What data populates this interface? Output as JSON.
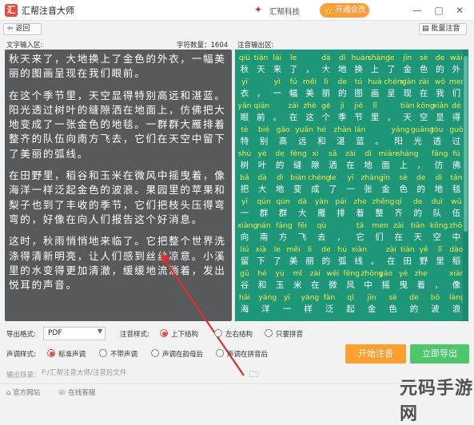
{
  "window": {
    "title": "汇帮注音大师",
    "brand": "汇帮科技",
    "vip_label": "开通会员",
    "minimize": "—",
    "maximize": "▢",
    "close": "✕"
  },
  "toolbar": {
    "back_label": "返回",
    "batch_label": "批量注音"
  },
  "input_area": {
    "label": "文字输入区:",
    "char_count_label": "字符数量：1604",
    "paragraphs": [
      "秋天来了，大地换上了金色的外衣，一幅美丽的图画呈现在我们眼前。",
      "在这个季节里，天空显得特别高远和湛蓝。阳光透过树叶的缝隙洒在地面上，仿佛把大地变成了一张金色的地毯。一群群大雁排着整齐的队伍向南方飞去，它们在天空中留下了美丽的弧线。",
      "在田野里，稻谷和玉米在微风中摇曳着，像海洋一样泛起金色的波浪。果园里的苹果和梨子也到了丰收的季节，它们把枝头压得弯弯的，好像在向人们报告这个好消息。",
      "这时，秋雨悄悄地来临了。它把整个世界洗涤得清新明亮，让人们感到丝丝凉意。小溪里的水变得更加清澈，缓缓地流淌着，发出悦耳的声音。"
    ]
  },
  "output_area": {
    "label": "注音输出区:",
    "rows": [
      {
        "py": [
          "qiū",
          "tiān",
          "lái",
          "le",
          "",
          "dà",
          "dì",
          "huàn",
          "shàng",
          "le",
          "jīn",
          "sè",
          "de",
          "wài"
        ],
        "hz": [
          "秋",
          "天",
          "来",
          "了",
          "，",
          "大",
          "地",
          "换",
          "上",
          "了",
          "金",
          "色",
          "的",
          "外"
        ]
      },
      {
        "py": [
          "yī",
          "",
          "yì",
          "fú",
          "měi",
          "lì",
          "de",
          "tú",
          "huà",
          "chéng",
          "xiàn",
          "zài",
          "wǒ",
          "men"
        ],
        "hz": [
          "衣",
          "，",
          "一",
          "幅",
          "美",
          "丽",
          "的",
          "图",
          "画",
          "呈",
          "现",
          "在",
          "我",
          "们"
        ]
      },
      {
        "py": [
          "yǎn",
          "qián",
          "",
          "zài",
          "zhè",
          "gè",
          "jì",
          "jié",
          "lǐ",
          "",
          "tiān",
          "kōng",
          "xiǎn",
          "dé"
        ],
        "hz": [
          "眼",
          "前",
          "。",
          "在",
          "这",
          "个",
          "季",
          "节",
          "里",
          "，",
          "天",
          "空",
          "显",
          "得"
        ]
      },
      {
        "py": [
          "tè",
          "bié",
          "gāo",
          "yuǎn",
          "hé",
          "zhàn",
          "lán",
          "",
          "yáng",
          "guāng",
          "tòu",
          "guò"
        ],
        "hz": [
          "特",
          "别",
          "高",
          "远",
          "和",
          "湛",
          "蓝",
          "。",
          "阳",
          "光",
          "透",
          "过"
        ]
      },
      {
        "py": [
          "shù",
          "yè",
          "de",
          "fèng",
          "xì",
          "sǎ",
          "zài",
          "dì",
          "miàn",
          "shàng",
          "",
          "fǎng",
          "fú"
        ],
        "hz": [
          "树",
          "叶",
          "的",
          "缝",
          "隙",
          "洒",
          "在",
          "地",
          "面",
          "上",
          "，",
          "仿",
          "佛"
        ]
      },
      {
        "py": [
          "bǎ",
          "dà",
          "dì",
          "biàn",
          "chéng",
          "le",
          "yī",
          "zhāng",
          "jīn",
          "sè",
          "de",
          "dì",
          "tǎn"
        ],
        "hz": [
          "把",
          "大",
          "地",
          "变",
          "成",
          "了",
          "一",
          "张",
          "金",
          "色",
          "的",
          "地",
          "毯"
        ]
      },
      {
        "py": [
          "yī",
          "qún",
          "qún",
          "dà",
          "yàn",
          "pái",
          "zhe",
          "zhěng",
          "qí",
          "de",
          "duì",
          "wǔ"
        ],
        "hz": [
          "一",
          "群",
          "群",
          "大",
          "雁",
          "排",
          "着",
          "整",
          "齐",
          "的",
          "队",
          "伍"
        ]
      },
      {
        "py": [
          "xiàng",
          "nán",
          "fāng",
          "fēi",
          "qù",
          "",
          "tā",
          "men",
          "zài",
          "tiān",
          "kōng",
          "zhōng"
        ],
        "hz": [
          "向",
          "南",
          "方",
          "飞",
          "去",
          "，",
          "它",
          "们",
          "在",
          "天",
          "空",
          "中"
        ]
      },
      {
        "py": [
          "liú",
          "xià",
          "le",
          "měi",
          "lì",
          "de",
          "hú",
          "xiàn",
          "",
          "zài",
          "tián",
          "yě",
          "lǐ",
          "dào"
        ],
        "hz": [
          "留",
          "下",
          "了",
          "美",
          "丽",
          "的",
          "弧",
          "线",
          "。",
          "在",
          "田",
          "野",
          "里",
          "稻"
        ]
      },
      {
        "py": [
          "gǔ",
          "hé",
          "yù",
          "mǐ",
          "zài",
          "wēi",
          "fēng",
          "zhōng",
          "yáo",
          "yè",
          "zhe",
          "",
          "xiàng"
        ],
        "hz": [
          "谷",
          "和",
          "玉",
          "米",
          "在",
          "微",
          "风",
          "中",
          "摇",
          "曳",
          "着",
          "，",
          "像"
        ]
      },
      {
        "py": [
          "hǎi",
          "yáng",
          "yī",
          "yàng",
          "fàn",
          "qǐ",
          "jīn",
          "sè",
          "de",
          "bō",
          "làng"
        ],
        "hz": [
          "海",
          "洋",
          "一",
          "样",
          "泛",
          "起",
          "金",
          "色",
          "的",
          "波",
          "浪"
        ]
      }
    ]
  },
  "settings": {
    "export_format_label": "导出格式:",
    "export_format_value": "PDF",
    "pinyin_style_label": "注音样式:",
    "pinyin_options": [
      "上下结构",
      "左右结构",
      "只要拼音"
    ],
    "pinyin_selected": 0,
    "tone_style_label": "声调样式:",
    "tone_options": [
      "标准声调",
      "不带声调",
      "声调在韵母后",
      "声调在拼音后"
    ],
    "tone_selected": 0,
    "start_label": "开始注音",
    "export_label": "立即导出",
    "output_dir_label": "输出目录:",
    "output_dir_value": "F:/汇帮注音大师/注音后文件"
  },
  "statusbar": {
    "website_label": "官方网站",
    "support_label": "在线客服"
  },
  "watermark": "元码手游网",
  "colors": {
    "left_pane": "#58595b",
    "right_pane": "#1e9678",
    "pinyin": "#f5e94a",
    "start_button": "#ff9f2e",
    "export_button": "#4cc86b",
    "vip_button": "#ff9d3d",
    "selected_radio": "#e05050"
  }
}
